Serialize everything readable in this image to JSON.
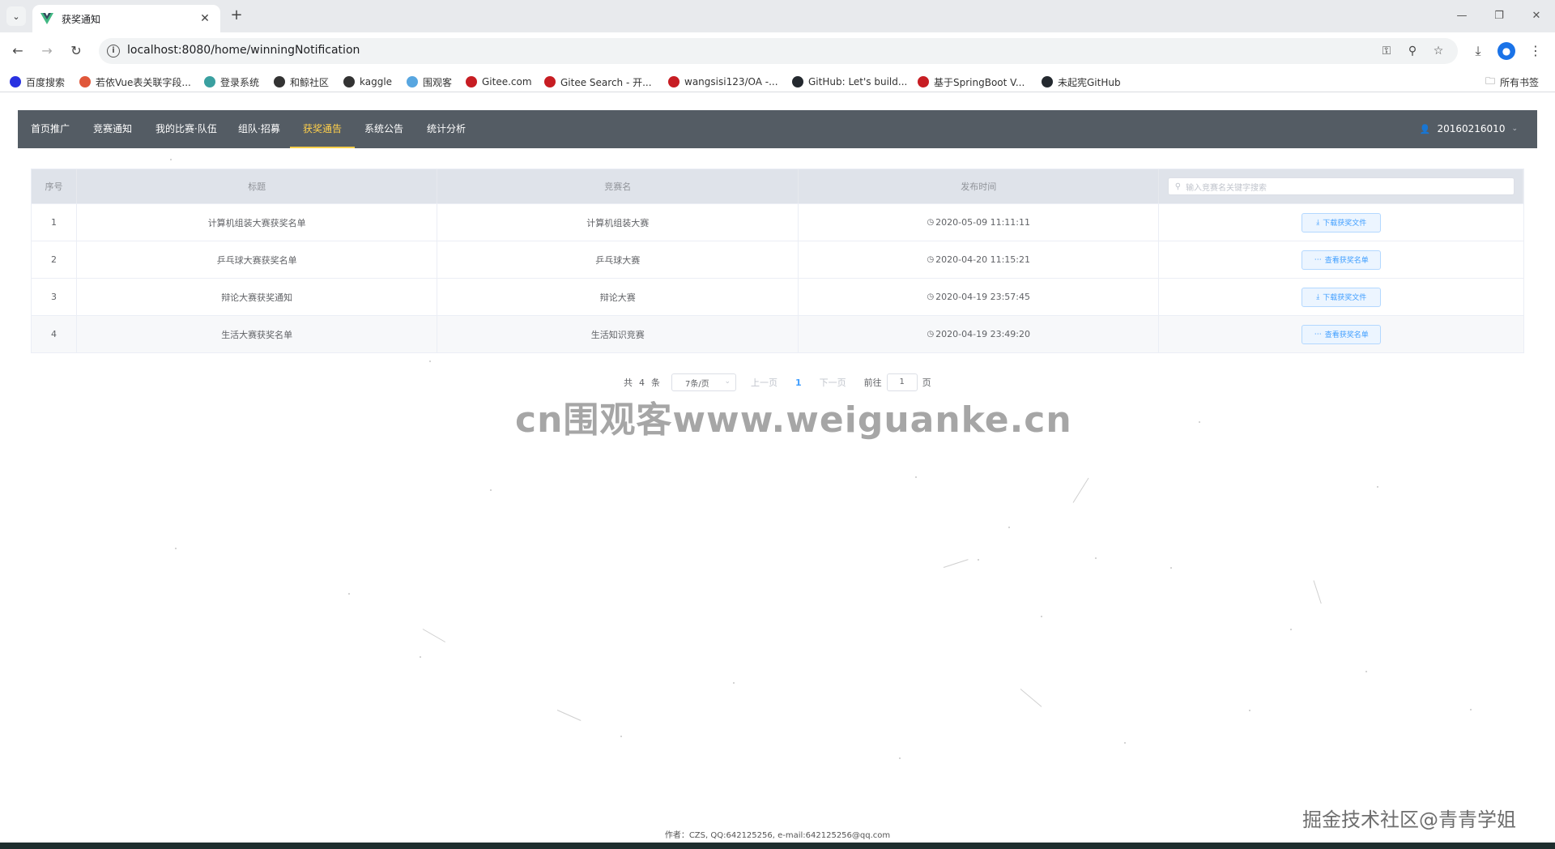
{
  "browser": {
    "tab_title": "获奖通知",
    "url": "localhost:8080/home/winningNotification",
    "bookmarks": [
      {
        "label": "百度搜索",
        "color": "#2932e1"
      },
      {
        "label": "若依Vue表关联字段...",
        "color": "#e0573a"
      },
      {
        "label": "登录系统",
        "color": "#3aa0a0"
      },
      {
        "label": "和鲸社区",
        "color": "#333333"
      },
      {
        "label": "kaggle",
        "color": "#333333"
      },
      {
        "label": "围观客",
        "color": "#58a6e0"
      },
      {
        "label": "Gitee.com",
        "color": "#c71d23"
      },
      {
        "label": "Gitee Search - 开...",
        "color": "#c71d23"
      },
      {
        "label": "wangsisi123/OA -...",
        "color": "#c71d23"
      },
      {
        "label": "GitHub: Let's build...",
        "color": "#24292f"
      },
      {
        "label": "基于SpringBoot V...",
        "color": "#c71d23"
      },
      {
        "label": "未起宪GitHub",
        "color": "#24292f"
      }
    ],
    "all_bookmarks": "所有书签"
  },
  "nav": {
    "items": [
      "首页推广",
      "竞赛通知",
      "我的比赛·队伍",
      "组队·招募",
      "获奖通告",
      "系统公告",
      "统计分析"
    ],
    "active_index": 4,
    "user": "20160216010"
  },
  "table": {
    "headers": {
      "no": "序号",
      "title": "标题",
      "competition": "竞赛名",
      "time": "发布时间"
    },
    "search_placeholder": "输入竞赛名关键字搜索",
    "rows": [
      {
        "no": "1",
        "title": "计算机组装大赛获奖名单",
        "competition": "计算机组装大赛",
        "time": "2020-05-09 11:11:11",
        "action": "下载获奖文件",
        "action_icon": "download-icon"
      },
      {
        "no": "2",
        "title": "乒乓球大赛获奖名单",
        "competition": "乒乓球大赛",
        "time": "2020-04-20 11:15:21",
        "action": "查看获奖名单",
        "action_icon": "more-icon"
      },
      {
        "no": "3",
        "title": "辩论大赛获奖通知",
        "competition": "辩论大赛",
        "time": "2020-04-19 23:57:45",
        "action": "下载获奖文件",
        "action_icon": "download-icon"
      },
      {
        "no": "4",
        "title": "生活大赛获奖名单",
        "competition": "生活知识竞赛",
        "time": "2020-04-19 23:49:20",
        "action": "查看获奖名单",
        "action_icon": "more-icon"
      }
    ]
  },
  "pagination": {
    "total_prefix": "共",
    "total": "4",
    "total_suffix": "条",
    "page_size": "7条/页",
    "prev": "上一页",
    "current": "1",
    "next": "下一页",
    "goto_prefix": "前往",
    "goto_value": "1",
    "goto_suffix": "页"
  },
  "watermark": "cn围观客www.weiguanke.cn",
  "corner_watermark": "掘金技术社区@青青学姐",
  "footer": "作者：CZS, QQ:642125256, e-mail:642125256@qq.com",
  "colors": {
    "nav_bg": "#545c64",
    "nav_active": "#ffd04b",
    "primary": "#409eff"
  }
}
